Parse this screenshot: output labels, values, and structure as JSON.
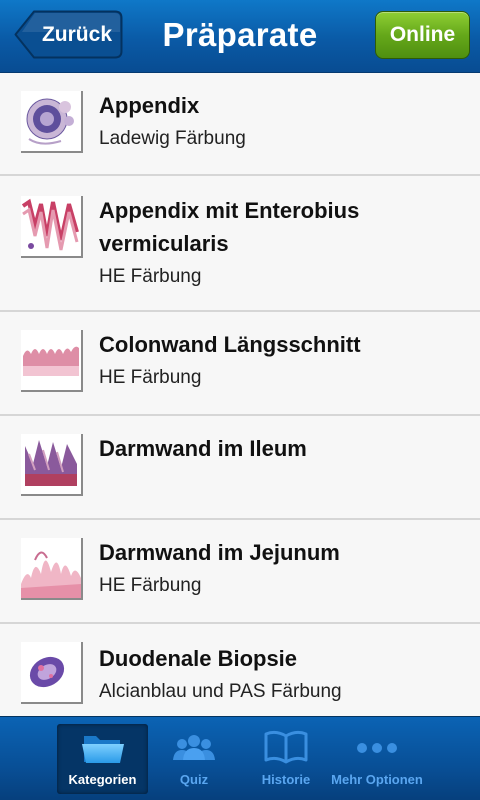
{
  "header": {
    "back_label": "Zurück",
    "title": "Präparate",
    "online_label": "Online"
  },
  "list": {
    "items": [
      {
        "title": "Appendix",
        "subtitle": "Ladewig Färbung"
      },
      {
        "title": "Appendix mit Enterobius vermicularis",
        "subtitle": "HE Färbung"
      },
      {
        "title": "Colonwand Längsschnitt",
        "subtitle": "HE Färbung"
      },
      {
        "title": "Darmwand im Ileum",
        "subtitle": ""
      },
      {
        "title": "Darmwand im Jejunum",
        "subtitle": "HE Färbung"
      },
      {
        "title": "Duodenale Biopsie",
        "subtitle": "Alcianblau und PAS Färbung"
      }
    ]
  },
  "tabs": [
    {
      "label": "Kategorien",
      "icon": "folder-icon",
      "active": true
    },
    {
      "label": "Quiz",
      "icon": "people-icon",
      "active": false
    },
    {
      "label": "Historie",
      "icon": "book-icon",
      "active": false
    },
    {
      "label": "Mehr Optionen",
      "icon": "more-dots-icon",
      "active": false
    }
  ],
  "colors": {
    "header_blue": "#0a5aa6",
    "online_green": "#65a81a",
    "tab_inactive": "#5aa6f0"
  }
}
